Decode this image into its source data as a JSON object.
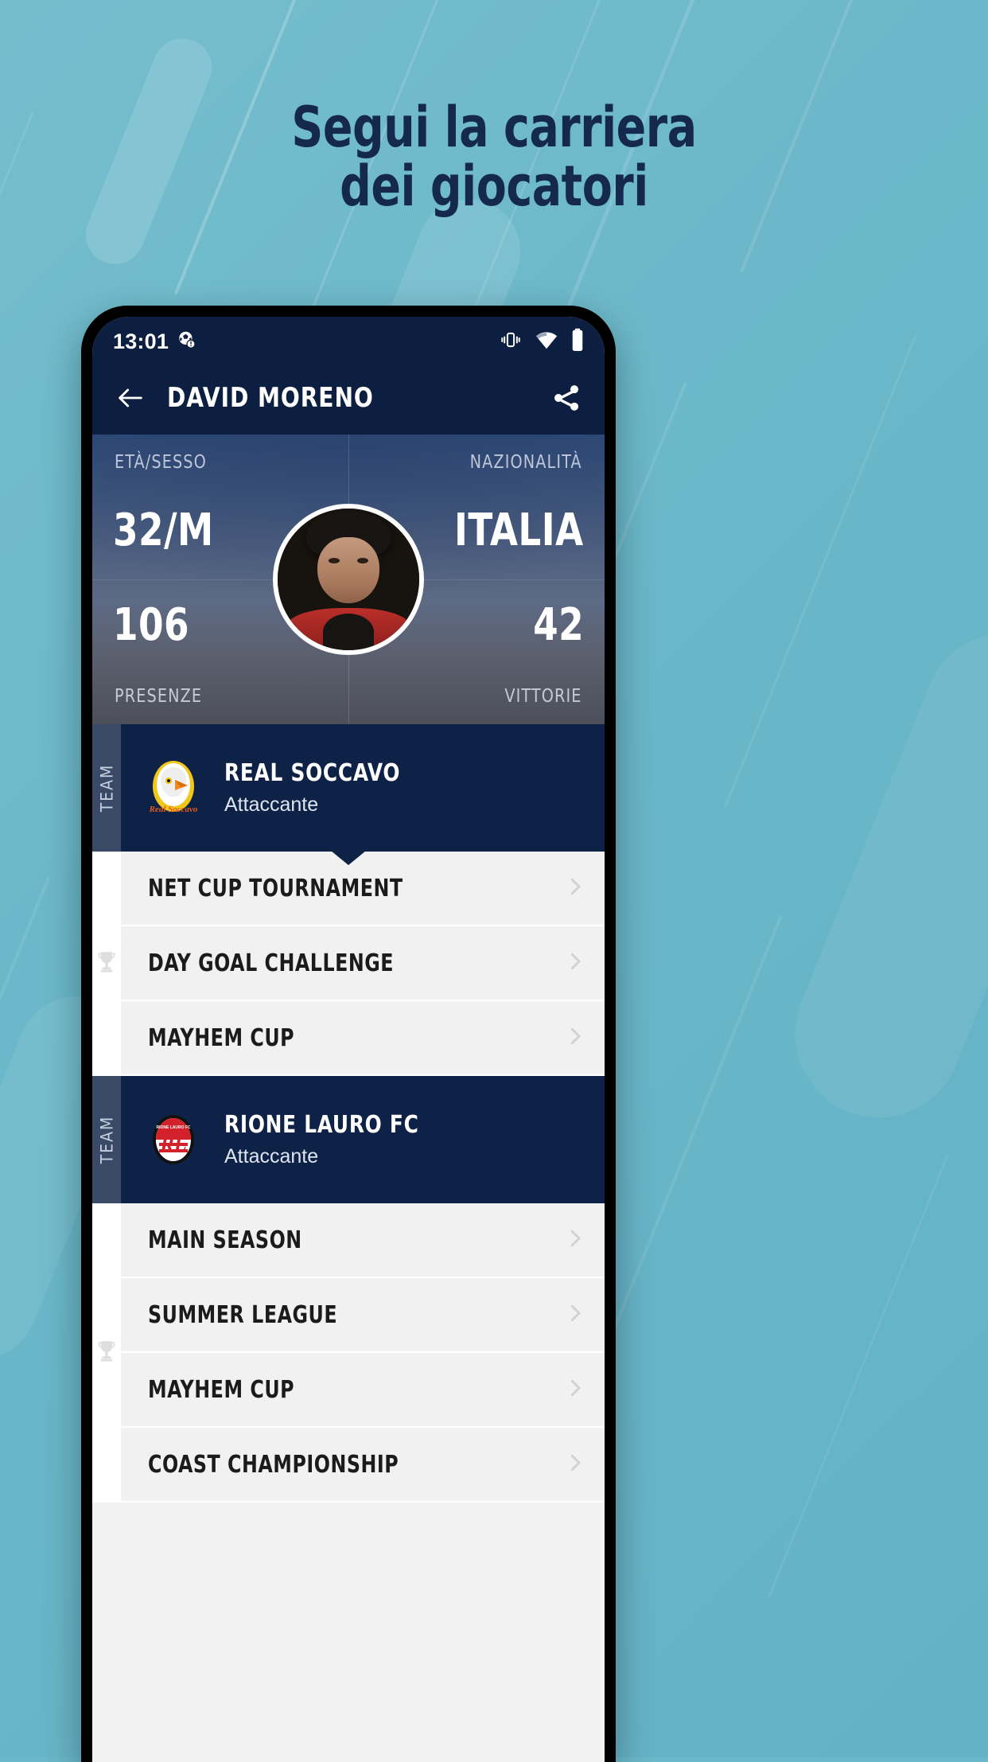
{
  "promo": {
    "headline_line1": "Segui la carriera",
    "headline_line2": "dei giocatori",
    "background_color": "#6bb8ca",
    "headline_color": "#15284d"
  },
  "status_bar": {
    "time": "13:01",
    "notification_icon": "soccer-ball-alert-icon",
    "vibrate_icon": "vibrate-icon",
    "wifi_icon": "wifi-icon",
    "battery_icon": "battery-full-icon"
  },
  "app_bar": {
    "back_icon": "arrow-left-icon",
    "title": "DAVID MORENO",
    "share_icon": "share-icon",
    "background_color": "#0d1f40"
  },
  "hero": {
    "age_sex_label": "ETÀ/SESSO",
    "age_sex_value": "32/M",
    "nationality_label": "NAZIONALITÀ",
    "nationality_value": "ITALIA",
    "appearances_value": "106",
    "appearances_label": "PRESENZE",
    "wins_value": "42",
    "wins_label": "VITTORIE",
    "avatar": "player-photo"
  },
  "teams": [
    {
      "side_label": "TEAM",
      "logo": "real-soccavo-eagle-crest-icon",
      "name": "REAL SOCCAVO",
      "role": "Attaccante",
      "tournaments": [
        {
          "name": "NET CUP TOURNAMENT",
          "chevron": "chevron-right-icon"
        },
        {
          "name": "DAY GOAL CHALLENGE",
          "chevron": "chevron-right-icon"
        },
        {
          "name": "MAYHEM CUP",
          "chevron": "chevron-right-icon"
        }
      ],
      "trophy_icon": "trophy-icon"
    },
    {
      "side_label": "TEAM",
      "logo": "rione-lauro-rl-crest-icon",
      "name": "RIONE LAURO FC",
      "role": "Attaccante",
      "tournaments": [
        {
          "name": "MAIN SEASON",
          "chevron": "chevron-right-icon"
        },
        {
          "name": "SUMMER LEAGUE",
          "chevron": "chevron-right-icon"
        },
        {
          "name": "MAYHEM CUP",
          "chevron": "chevron-right-icon"
        },
        {
          "name": "COAST CHAMPIONSHIP",
          "chevron": "chevron-right-icon"
        }
      ],
      "trophy_icon": "trophy-icon"
    }
  ]
}
